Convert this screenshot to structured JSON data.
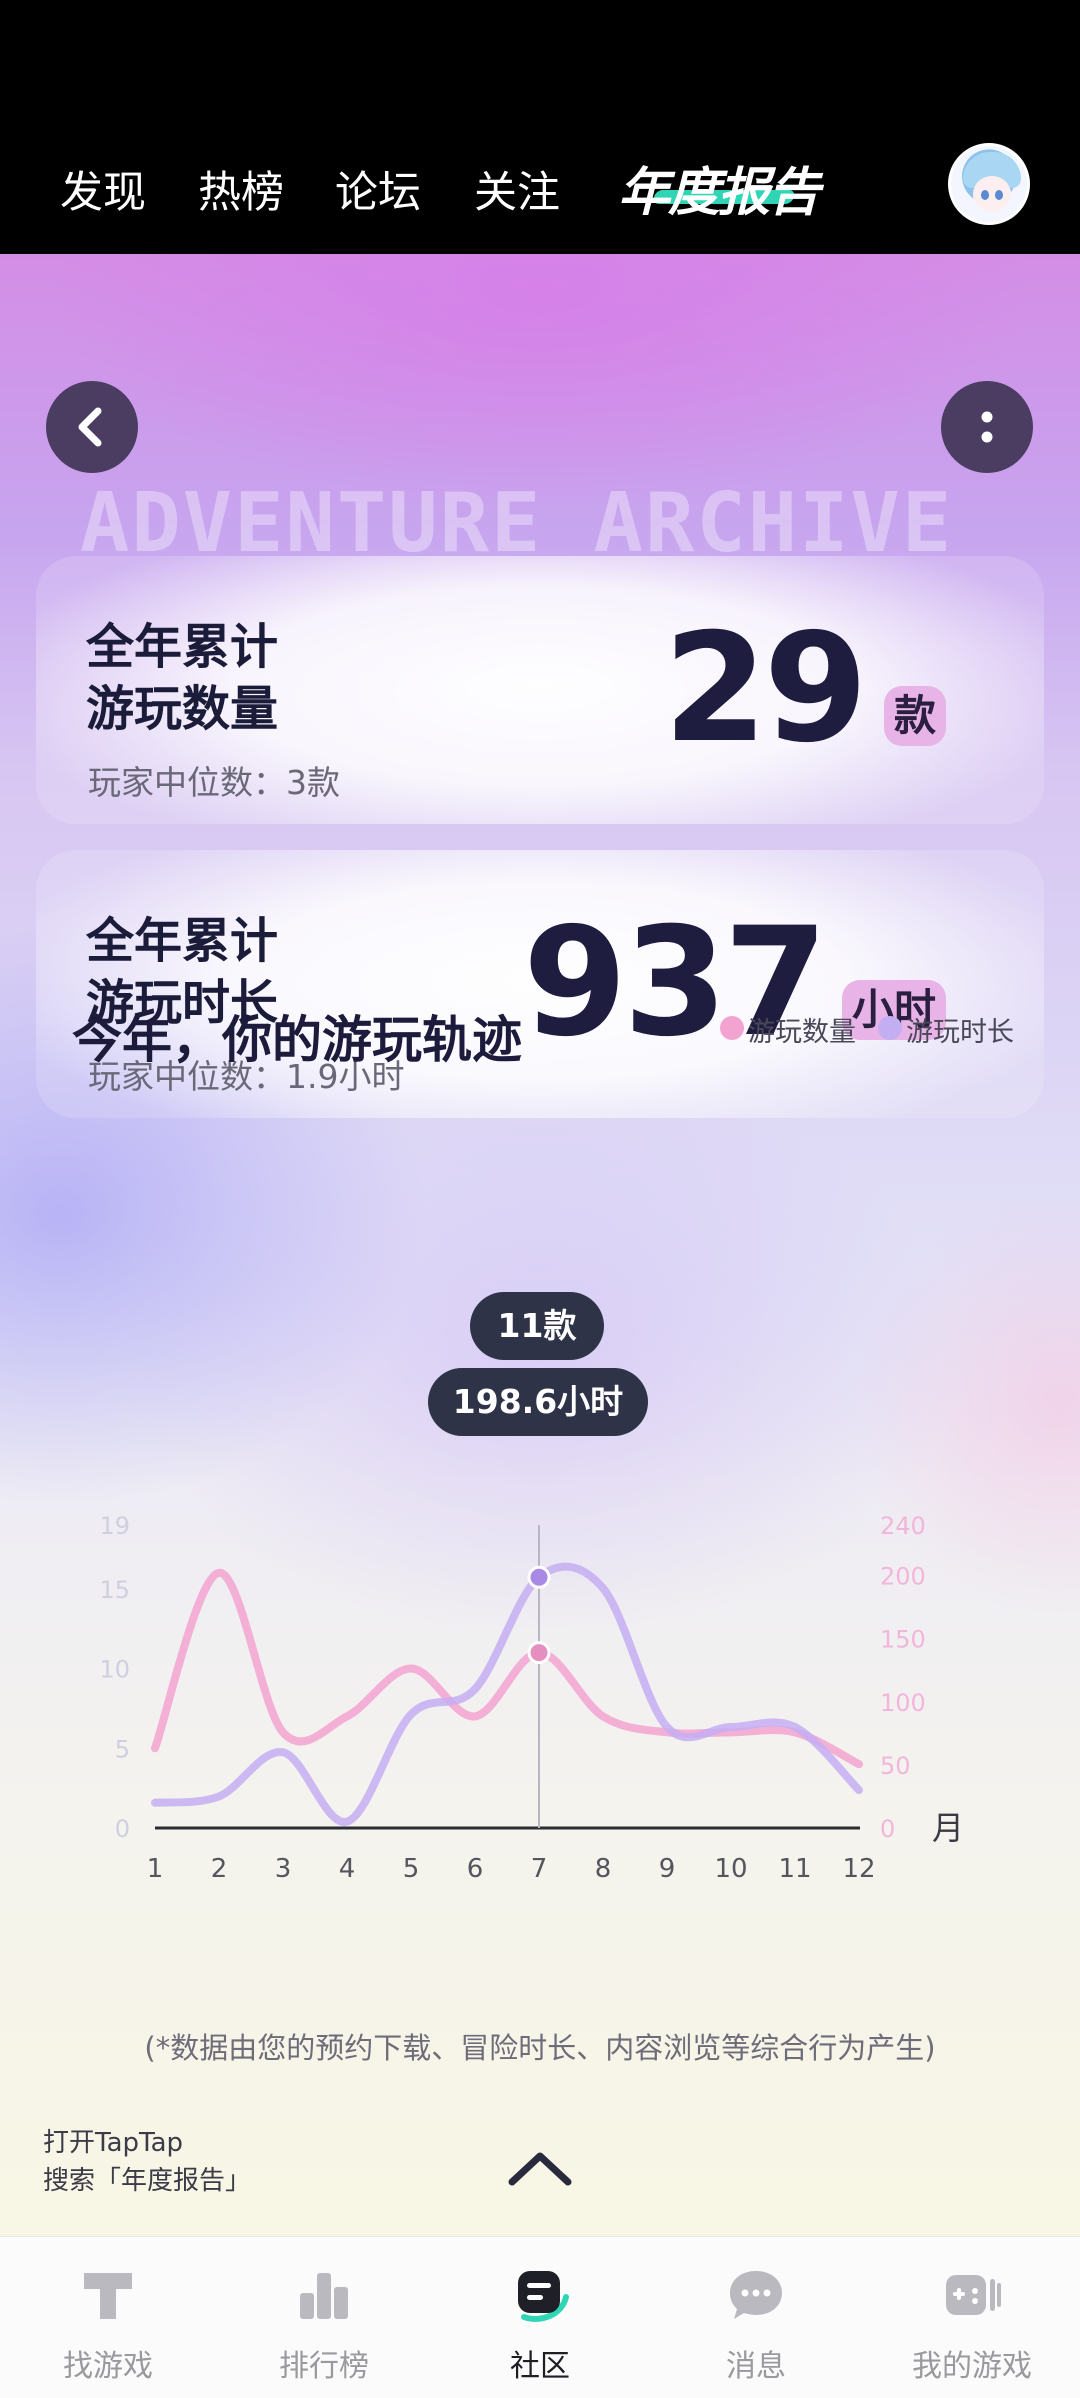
{
  "top_nav": {
    "items": [
      "发现",
      "热榜",
      "论坛",
      "关注"
    ],
    "report_logo": "年度报告"
  },
  "watermark": "ADVENTURE ARCHIVE",
  "cards": [
    {
      "title_line1": "全年累计",
      "title_line2": "游玩数量",
      "value": "29",
      "unit": "款",
      "median": "玩家中位数：3款"
    },
    {
      "title_line1": "全年累计",
      "title_line2": "游玩时长",
      "value": "937",
      "unit": "小时",
      "median": "玩家中位数：1.9小时"
    }
  ],
  "section": {
    "title": "今年，你的游玩轨迹",
    "legend": [
      {
        "label": "游玩数量",
        "color": "#f3a3d0"
      },
      {
        "label": "游玩时长",
        "color": "#c4aef2"
      }
    ]
  },
  "tooltips": {
    "count": "11款",
    "time": "198.6小时"
  },
  "chart_data": {
    "type": "line",
    "categories": [
      "1",
      "2",
      "3",
      "4",
      "5",
      "6",
      "7",
      "8",
      "9",
      "10",
      "11",
      "12"
    ],
    "x_unit": "月",
    "y_left_ticks": [
      "0",
      "5",
      "10",
      "15",
      "19"
    ],
    "y_right_ticks": [
      "0",
      "50",
      "100",
      "150",
      "200",
      "240"
    ],
    "ylim_left": [
      0,
      19
    ],
    "ylim_right": [
      0,
      240
    ],
    "highlight_month": "7",
    "series": [
      {
        "name": "游玩数量",
        "axis": "left",
        "color": "#f3a3d0",
        "values": [
          5,
          16,
          6,
          7,
          10,
          7,
          11,
          7,
          6,
          6,
          6,
          4
        ]
      },
      {
        "name": "游玩时长",
        "axis": "right",
        "color": "#c4aef2",
        "values": [
          20,
          25,
          60,
          5,
          90,
          110,
          198.6,
          190,
          80,
          80,
          80,
          30
        ]
      }
    ]
  },
  "footer_note": "(*数据由您的预约下载、冒险时长、内容浏览等综合行为产生)",
  "hint": {
    "line1": "打开TapTap",
    "line2": "搜索「年度报告」"
  },
  "tabbar": [
    {
      "label": "找游戏",
      "icon": "find-game-icon"
    },
    {
      "label": "排行榜",
      "icon": "ranking-icon"
    },
    {
      "label": "社区",
      "icon": "community-icon",
      "active": true
    },
    {
      "label": "消息",
      "icon": "message-icon"
    },
    {
      "label": "我的游戏",
      "icon": "my-games-icon"
    }
  ]
}
